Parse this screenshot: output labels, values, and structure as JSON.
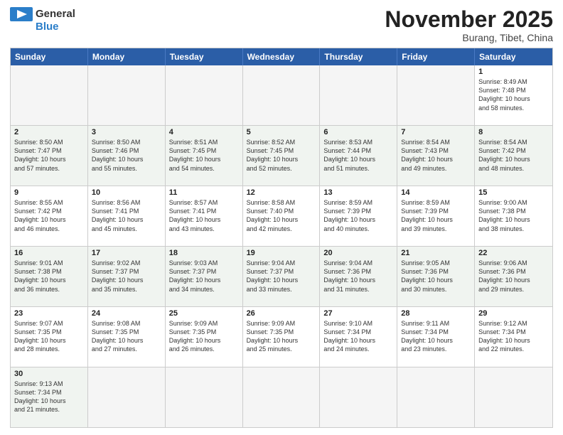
{
  "header": {
    "logo_general": "General",
    "logo_blue": "Blue",
    "month_title": "November 2025",
    "location": "Burang, Tibet, China"
  },
  "days_of_week": [
    "Sunday",
    "Monday",
    "Tuesday",
    "Wednesday",
    "Thursday",
    "Friday",
    "Saturday"
  ],
  "rows": [
    {
      "cells": [
        {
          "day": "",
          "info": "",
          "empty": true
        },
        {
          "day": "",
          "info": "",
          "empty": true
        },
        {
          "day": "",
          "info": "",
          "empty": true
        },
        {
          "day": "",
          "info": "",
          "empty": true
        },
        {
          "day": "",
          "info": "",
          "empty": true
        },
        {
          "day": "",
          "info": "",
          "empty": true
        },
        {
          "day": "1",
          "info": "Sunrise: 8:49 AM\nSunset: 7:48 PM\nDaylight: 10 hours\nand 58 minutes."
        }
      ]
    },
    {
      "cells": [
        {
          "day": "2",
          "info": "Sunrise: 8:50 AM\nSunset: 7:47 PM\nDaylight: 10 hours\nand 57 minutes."
        },
        {
          "day": "3",
          "info": "Sunrise: 8:50 AM\nSunset: 7:46 PM\nDaylight: 10 hours\nand 55 minutes."
        },
        {
          "day": "4",
          "info": "Sunrise: 8:51 AM\nSunset: 7:45 PM\nDaylight: 10 hours\nand 54 minutes."
        },
        {
          "day": "5",
          "info": "Sunrise: 8:52 AM\nSunset: 7:45 PM\nDaylight: 10 hours\nand 52 minutes."
        },
        {
          "day": "6",
          "info": "Sunrise: 8:53 AM\nSunset: 7:44 PM\nDaylight: 10 hours\nand 51 minutes."
        },
        {
          "day": "7",
          "info": "Sunrise: 8:54 AM\nSunset: 7:43 PM\nDaylight: 10 hours\nand 49 minutes."
        },
        {
          "day": "8",
          "info": "Sunrise: 8:54 AM\nSunset: 7:42 PM\nDaylight: 10 hours\nand 48 minutes."
        }
      ]
    },
    {
      "cells": [
        {
          "day": "9",
          "info": "Sunrise: 8:55 AM\nSunset: 7:42 PM\nDaylight: 10 hours\nand 46 minutes."
        },
        {
          "day": "10",
          "info": "Sunrise: 8:56 AM\nSunset: 7:41 PM\nDaylight: 10 hours\nand 45 minutes."
        },
        {
          "day": "11",
          "info": "Sunrise: 8:57 AM\nSunset: 7:41 PM\nDaylight: 10 hours\nand 43 minutes."
        },
        {
          "day": "12",
          "info": "Sunrise: 8:58 AM\nSunset: 7:40 PM\nDaylight: 10 hours\nand 42 minutes."
        },
        {
          "day": "13",
          "info": "Sunrise: 8:59 AM\nSunset: 7:39 PM\nDaylight: 10 hours\nand 40 minutes."
        },
        {
          "day": "14",
          "info": "Sunrise: 8:59 AM\nSunset: 7:39 PM\nDaylight: 10 hours\nand 39 minutes."
        },
        {
          "day": "15",
          "info": "Sunrise: 9:00 AM\nSunset: 7:38 PM\nDaylight: 10 hours\nand 38 minutes."
        }
      ]
    },
    {
      "cells": [
        {
          "day": "16",
          "info": "Sunrise: 9:01 AM\nSunset: 7:38 PM\nDaylight: 10 hours\nand 36 minutes."
        },
        {
          "day": "17",
          "info": "Sunrise: 9:02 AM\nSunset: 7:37 PM\nDaylight: 10 hours\nand 35 minutes."
        },
        {
          "day": "18",
          "info": "Sunrise: 9:03 AM\nSunset: 7:37 PM\nDaylight: 10 hours\nand 34 minutes."
        },
        {
          "day": "19",
          "info": "Sunrise: 9:04 AM\nSunset: 7:37 PM\nDaylight: 10 hours\nand 33 minutes."
        },
        {
          "day": "20",
          "info": "Sunrise: 9:04 AM\nSunset: 7:36 PM\nDaylight: 10 hours\nand 31 minutes."
        },
        {
          "day": "21",
          "info": "Sunrise: 9:05 AM\nSunset: 7:36 PM\nDaylight: 10 hours\nand 30 minutes."
        },
        {
          "day": "22",
          "info": "Sunrise: 9:06 AM\nSunset: 7:36 PM\nDaylight: 10 hours\nand 29 minutes."
        }
      ]
    },
    {
      "cells": [
        {
          "day": "23",
          "info": "Sunrise: 9:07 AM\nSunset: 7:35 PM\nDaylight: 10 hours\nand 28 minutes."
        },
        {
          "day": "24",
          "info": "Sunrise: 9:08 AM\nSunset: 7:35 PM\nDaylight: 10 hours\nand 27 minutes."
        },
        {
          "day": "25",
          "info": "Sunrise: 9:09 AM\nSunset: 7:35 PM\nDaylight: 10 hours\nand 26 minutes."
        },
        {
          "day": "26",
          "info": "Sunrise: 9:09 AM\nSunset: 7:35 PM\nDaylight: 10 hours\nand 25 minutes."
        },
        {
          "day": "27",
          "info": "Sunrise: 9:10 AM\nSunset: 7:34 PM\nDaylight: 10 hours\nand 24 minutes."
        },
        {
          "day": "28",
          "info": "Sunrise: 9:11 AM\nSunset: 7:34 PM\nDaylight: 10 hours\nand 23 minutes."
        },
        {
          "day": "29",
          "info": "Sunrise: 9:12 AM\nSunset: 7:34 PM\nDaylight: 10 hours\nand 22 minutes."
        }
      ]
    },
    {
      "cells": [
        {
          "day": "30",
          "info": "Sunrise: 9:13 AM\nSunset: 7:34 PM\nDaylight: 10 hours\nand 21 minutes."
        },
        {
          "day": "",
          "info": "",
          "empty": true
        },
        {
          "day": "",
          "info": "",
          "empty": true
        },
        {
          "day": "",
          "info": "",
          "empty": true
        },
        {
          "day": "",
          "info": "",
          "empty": true
        },
        {
          "day": "",
          "info": "",
          "empty": true
        },
        {
          "day": "",
          "info": "",
          "empty": true
        }
      ]
    }
  ]
}
